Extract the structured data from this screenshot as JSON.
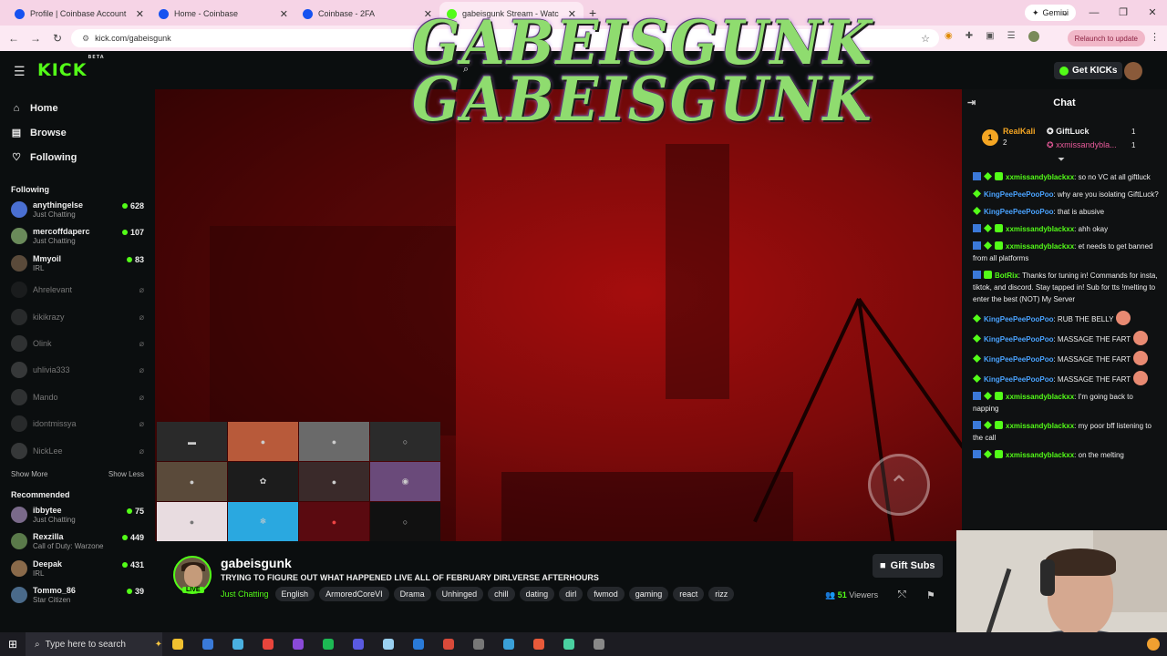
{
  "browser": {
    "tabs": [
      {
        "title": "Profile | Coinbase Account",
        "color": "#1652f0"
      },
      {
        "title": "Home - Coinbase",
        "color": "#1652f0"
      },
      {
        "title": "Coinbase - 2FA",
        "color": "#1652f0"
      },
      {
        "title": "gabeisgunk Stream - Watc",
        "color": "#53fc18"
      }
    ],
    "gemini_label": "Gemini",
    "url": "kick.com/gabeisgunk",
    "relaunch_label": "Relaunch to update"
  },
  "kick": {
    "logo": "KICK",
    "logo_beta": "BETA",
    "get_kicks": "Get KICKs",
    "nav": [
      {
        "label": "Home",
        "icon": "home-icon"
      },
      {
        "label": "Browse",
        "icon": "browse-icon"
      },
      {
        "label": "Following",
        "icon": "heart-icon"
      }
    ],
    "following_title": "Following",
    "following": [
      {
        "name": "anythingelse",
        "category": "Just Chatting",
        "viewers": "628",
        "color": "#4a6fd1",
        "live": true
      },
      {
        "name": "mercoffdaperc",
        "category": "Just Chatting",
        "viewers": "107",
        "color": "#6a8a5a",
        "live": true
      },
      {
        "name": "Mmyoil",
        "category": "IRL",
        "viewers": "83",
        "color": "#5a4a3a",
        "live": true
      },
      {
        "name": "Ahrelevant",
        "category": "",
        "viewers": "",
        "color": "#333",
        "live": false
      },
      {
        "name": "kikikrazy",
        "category": "",
        "viewers": "",
        "color": "#555",
        "live": false
      },
      {
        "name": "Olink",
        "category": "",
        "viewers": "",
        "color": "#666",
        "live": false
      },
      {
        "name": "uhlivia333",
        "category": "",
        "viewers": "",
        "color": "#777",
        "live": false
      },
      {
        "name": "Mando",
        "category": "",
        "viewers": "",
        "color": "#666",
        "live": false
      },
      {
        "name": "idontmissya",
        "category": "",
        "viewers": "",
        "color": "#555",
        "live": false
      },
      {
        "name": "NickLee",
        "category": "",
        "viewers": "",
        "color": "#777",
        "live": false
      }
    ],
    "show_more": "Show More",
    "show_less": "Show Less",
    "recommended_title": "Recommended",
    "recommended": [
      {
        "name": "ibbytee",
        "category": "Just Chatting",
        "viewers": "75",
        "color": "#7a6a8a"
      },
      {
        "name": "Rexzilla",
        "category": "Call of Duty: Warzone",
        "viewers": "449",
        "color": "#5a7a4a"
      },
      {
        "name": "Deepak",
        "category": "IRL",
        "viewers": "431",
        "color": "#8a6a4a"
      },
      {
        "name": "Tommo_86",
        "category": "Star Citizen",
        "viewers": "39",
        "color": "#4a6a8a"
      }
    ]
  },
  "overlay": {
    "logo_line_1": "GABEISGUNK",
    "logo_line_2": "GABEISGUNK"
  },
  "stream": {
    "streamer": "gabeisgunk",
    "live_badge": "LIVE",
    "title": "TRYING TO FIGURE OUT WHAT HAPPENED  LIVE ALL OF FEBRUARY DIRLVERSE AFTERHOURS",
    "category": "Just Chatting",
    "tags": [
      "English",
      "ArmoredCoreVI",
      "Drama",
      "Unhinged",
      "chill",
      "dating",
      "dirl",
      "fwmod",
      "gaming",
      "react",
      "rizz"
    ],
    "viewer_count": "51",
    "viewers_label": "Viewers",
    "gift_subs": "Gift Subs"
  },
  "chat": {
    "title": "Chat",
    "top_gifters": [
      {
        "rank": "1",
        "name": "RealKali",
        "count": "2"
      },
      {
        "name": "GiftLuck",
        "count": "1"
      },
      {
        "name": "xxmissandybla...",
        "count": "1"
      }
    ],
    "messages": [
      {
        "user": "xxmissandyblackxx",
        "color": "#53fc18",
        "text": "so no VC at all giftluck",
        "badges": [
          "b-blue",
          "b-green",
          "b-sub"
        ],
        "emote": false
      },
      {
        "user": "KingPeePeePooPoo",
        "color": "#4aa3ff",
        "text": "why are you isolating GiftLuck?",
        "badges": [
          "b-green"
        ],
        "emote": false
      },
      {
        "user": "KingPeePeePooPoo",
        "color": "#4aa3ff",
        "text": "that is abusive",
        "badges": [
          "b-green"
        ],
        "emote": false
      },
      {
        "user": "xxmissandyblackxx",
        "color": "#53fc18",
        "text": "ahh okay",
        "badges": [
          "b-blue",
          "b-green",
          "b-sub"
        ],
        "emote": false
      },
      {
        "user": "xxmissandyblackxx",
        "color": "#53fc18",
        "text": "et needs to get banned from all platforms",
        "badges": [
          "b-blue",
          "b-green",
          "b-sub"
        ],
        "emote": false
      },
      {
        "user": "BotRix",
        "color": "#53fc18",
        "text": "Thanks for tuning in! Commands for insta, tiktok, and discord. Stay tapped in! Sub for tts !melting to enter the best (NOT) My Server",
        "badges": [
          "b-blue",
          "b-sub"
        ],
        "emote": false
      },
      {
        "user": "KingPeePeePooPoo",
        "color": "#4aa3ff",
        "text": "RUB THE BELLY",
        "badges": [
          "b-green"
        ],
        "emote": true
      },
      {
        "user": "KingPeePeePooPoo",
        "color": "#4aa3ff",
        "text": "MASSAGE THE FART",
        "badges": [
          "b-green"
        ],
        "emote": true
      },
      {
        "user": "KingPeePeePooPoo",
        "color": "#4aa3ff",
        "text": "MASSAGE THE FART",
        "badges": [
          "b-green"
        ],
        "emote": true
      },
      {
        "user": "KingPeePeePooPoo",
        "color": "#4aa3ff",
        "text": "MASSAGE THE FART",
        "badges": [
          "b-green"
        ],
        "emote": true
      },
      {
        "user": "xxmissandyblackxx",
        "color": "#53fc18",
        "text": "I'm going back to napping",
        "badges": [
          "b-blue",
          "b-green",
          "b-sub"
        ],
        "emote": false
      },
      {
        "user": "xxmissandyblackxx",
        "color": "#53fc18",
        "text": "my poor bff listening to the call",
        "badges": [
          "b-blue",
          "b-green",
          "b-sub"
        ],
        "emote": false
      },
      {
        "user": "xxmissandyblackxx",
        "color": "#53fc18",
        "text": "on the melting",
        "badges": [
          "b-blue",
          "b-green",
          "b-sub"
        ],
        "emote": false
      }
    ]
  },
  "taskbar": {
    "search_placeholder": "Type here to search",
    "apps": [
      "#f0c030",
      "#3a7ad8",
      "#4ab0e0",
      "#e8453c",
      "#8a4ad8",
      "#1db954",
      "#5a5ae0",
      "#9ad0f0",
      "#2a7ad8",
      "#d84a3a",
      "#777",
      "#3aa0d8",
      "#e85a3a",
      "#4ad0a0",
      "#888"
    ]
  }
}
